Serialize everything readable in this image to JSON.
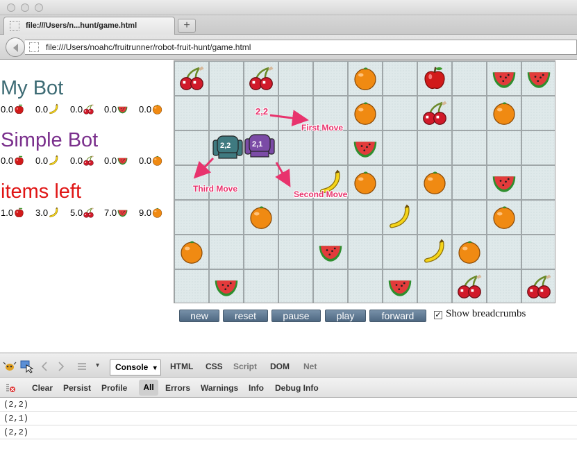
{
  "browser": {
    "tab_title": "file:///Users/n...hunt/game.html",
    "new_tab_label": "+",
    "url": "file:///Users/noahc/fruitrunner/robot-fruit-hunt/game.html"
  },
  "scoreboard": [
    {
      "title": "My Bot",
      "color": "#3d6b74",
      "scores": [
        {
          "value": "0.0",
          "icon": "apple"
        },
        {
          "value": "0.0",
          "icon": "banana"
        },
        {
          "value": "0.0",
          "icon": "cherry"
        },
        {
          "value": "0.0",
          "icon": "watermelon"
        },
        {
          "value": "0.0",
          "icon": "orange"
        }
      ]
    },
    {
      "title": "Simple Bot",
      "color": "#7a2f8c",
      "scores": [
        {
          "value": "0.0",
          "icon": "apple"
        },
        {
          "value": "0.0",
          "icon": "banana"
        },
        {
          "value": "0.0",
          "icon": "cherry"
        },
        {
          "value": "0.0",
          "icon": "watermelon"
        },
        {
          "value": "0.0",
          "icon": "orange"
        }
      ]
    },
    {
      "title": "items left",
      "color": "#e01515",
      "scores": [
        {
          "value": "1.0",
          "icon": "apple"
        },
        {
          "value": "3.0",
          "icon": "banana"
        },
        {
          "value": "5.0",
          "icon": "cherry"
        },
        {
          "value": "7.0",
          "icon": "watermelon"
        },
        {
          "value": "9.0",
          "icon": "orange"
        }
      ]
    }
  ],
  "board": {
    "cols": 11,
    "rows": 7,
    "fruits": [
      {
        "col": 0,
        "row": 0,
        "type": "cherry"
      },
      {
        "col": 2,
        "row": 0,
        "type": "cherry"
      },
      {
        "col": 5,
        "row": 0,
        "type": "orange"
      },
      {
        "col": 7,
        "row": 0,
        "type": "apple"
      },
      {
        "col": 9,
        "row": 0,
        "type": "watermelon"
      },
      {
        "col": 10,
        "row": 0,
        "type": "watermelon"
      },
      {
        "col": 5,
        "row": 1,
        "type": "orange"
      },
      {
        "col": 7,
        "row": 1,
        "type": "cherry"
      },
      {
        "col": 9,
        "row": 1,
        "type": "orange"
      },
      {
        "col": 5,
        "row": 2,
        "type": "watermelon"
      },
      {
        "col": 4,
        "row": 3,
        "type": "banana"
      },
      {
        "col": 5,
        "row": 3,
        "type": "orange"
      },
      {
        "col": 7,
        "row": 3,
        "type": "orange"
      },
      {
        "col": 9,
        "row": 3,
        "type": "watermelon"
      },
      {
        "col": 2,
        "row": 4,
        "type": "orange"
      },
      {
        "col": 6,
        "row": 4,
        "type": "banana"
      },
      {
        "col": 9,
        "row": 4,
        "type": "orange"
      },
      {
        "col": 0,
        "row": 5,
        "type": "orange"
      },
      {
        "col": 4,
        "row": 5,
        "type": "watermelon"
      },
      {
        "col": 7,
        "row": 5,
        "type": "banana"
      },
      {
        "col": 8,
        "row": 5,
        "type": "orange"
      },
      {
        "col": 1,
        "row": 6,
        "type": "watermelon"
      },
      {
        "col": 6,
        "row": 6,
        "type": "watermelon"
      },
      {
        "col": 8,
        "row": 6,
        "type": "cherry"
      },
      {
        "col": 10,
        "row": 6,
        "type": "cherry"
      }
    ],
    "robots": [
      {
        "name": "my-bot",
        "label": "2,2",
        "color": "#3f7a80"
      },
      {
        "name": "simple-bot",
        "label": "2,1",
        "color": "#7b4ba6"
      }
    ],
    "annotations": {
      "coord_label": "2,2",
      "first_move": "First Move",
      "second_move": "Second Move",
      "third_move": "Third Move",
      "color": "#e8336d"
    }
  },
  "controls": {
    "new": "new",
    "reset": "reset",
    "pause": "pause",
    "play": "play",
    "forward": "forward",
    "breadcrumbs_label": "Show breadcrumbs",
    "breadcrumbs_checked": true,
    "check_mark": "✓"
  },
  "firebug": {
    "tabs": {
      "console": "Console",
      "html": "HTML",
      "css": "CSS",
      "script": "Script",
      "dom": "DOM",
      "net": "Net"
    },
    "console_dropdown_arrow": "▾",
    "filters": {
      "clear": "Clear",
      "persist": "Persist",
      "profile": "Profile",
      "all": "All",
      "errors": "Errors",
      "warnings": "Warnings",
      "info": "Info",
      "debug_info": "Debug Info"
    },
    "log": [
      "(2,2)",
      "(2,1)",
      "(2,2)"
    ]
  }
}
